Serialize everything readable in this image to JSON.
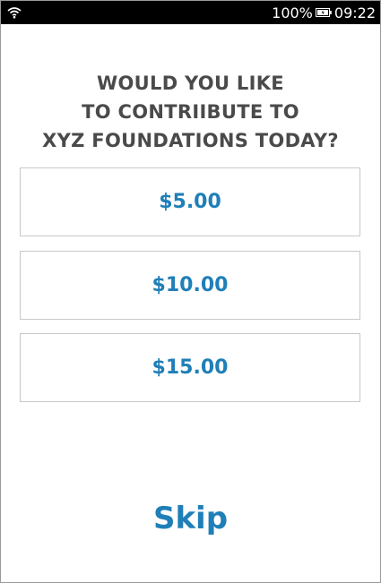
{
  "status_bar": {
    "signal_icon": "wifi-icon",
    "battery_percent": "100%",
    "battery_icon": "battery-icon",
    "time": "09:22"
  },
  "prompt": {
    "lines": [
      "WOULD YOU LIKE",
      "TO CONTRIIBUTE TO",
      "XYZ FOUNDATIONS TODAY?"
    ]
  },
  "options": [
    {
      "label": "$5.00"
    },
    {
      "label": "$10.00"
    },
    {
      "label": "$15.00"
    }
  ],
  "skip_label": "Skip",
  "colors": {
    "accent": "#1f7fb8",
    "heading": "#4a4a4a",
    "status_bar": "#000000",
    "border": "#c8c8c8"
  }
}
